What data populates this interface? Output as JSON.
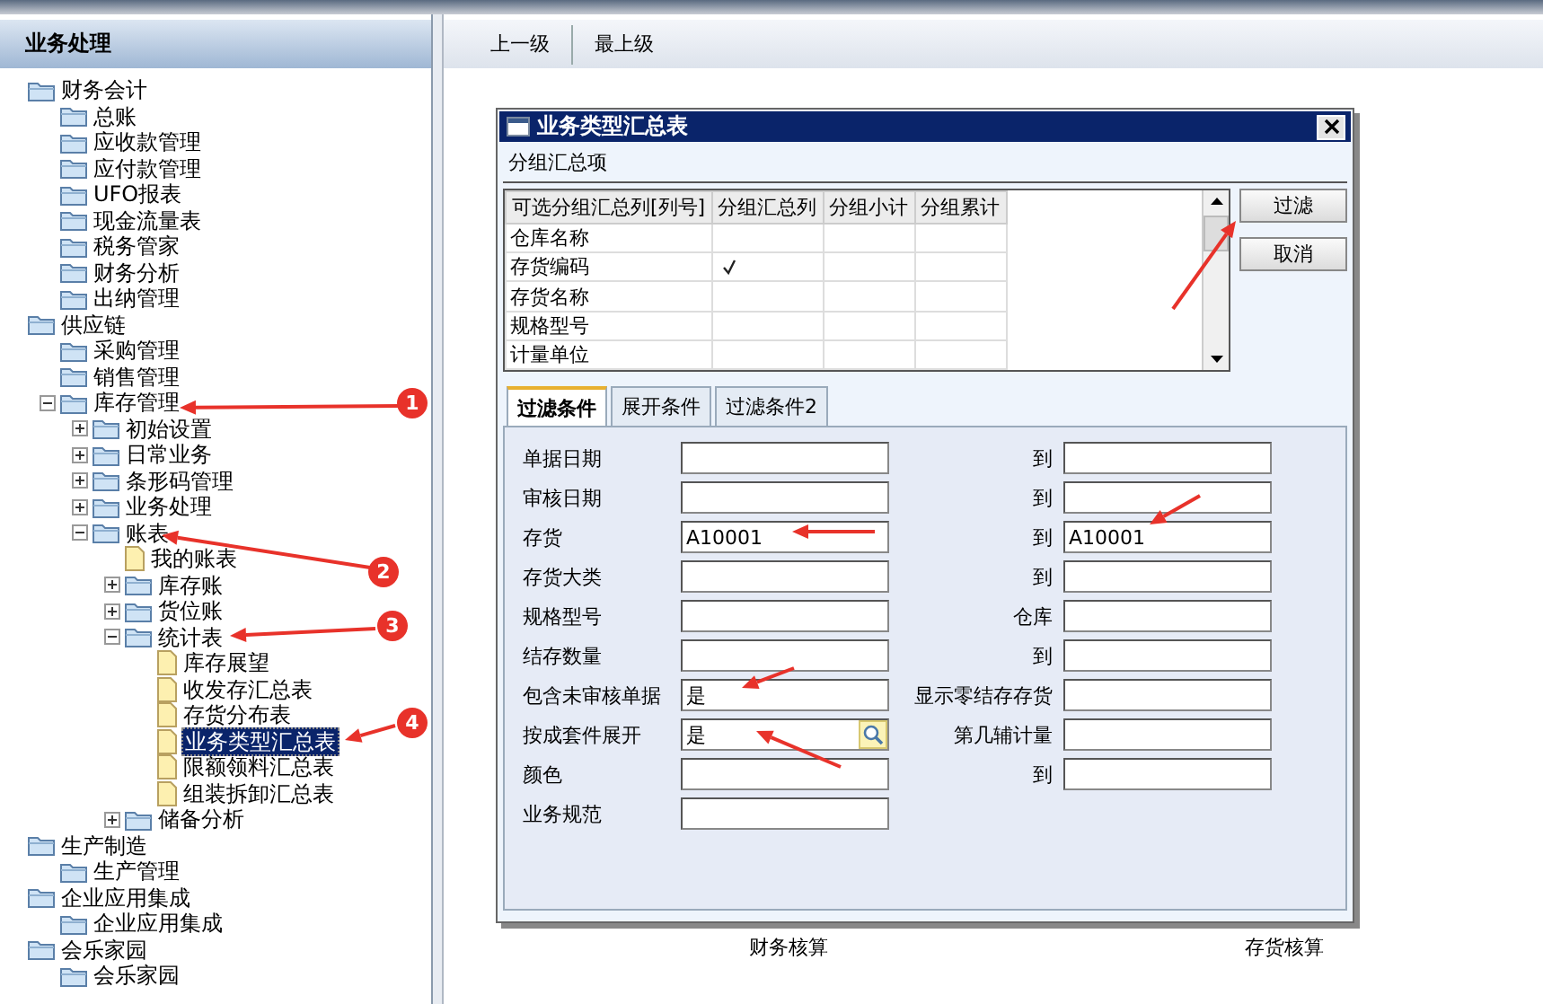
{
  "sidebar": {
    "title": "业务处理",
    "tree": [
      {
        "label": "财务会计",
        "kind": "folder",
        "selected": false,
        "children": [
          {
            "label": "总账",
            "kind": "folder",
            "selected": false
          },
          {
            "label": "应收款管理",
            "kind": "folder",
            "selected": false
          },
          {
            "label": "应付款管理",
            "kind": "folder",
            "selected": false
          },
          {
            "label": "UFO报表",
            "kind": "folder",
            "selected": false
          },
          {
            "label": "现金流量表",
            "kind": "folder",
            "selected": false
          },
          {
            "label": "税务管家",
            "kind": "folder",
            "selected": false
          },
          {
            "label": "财务分析",
            "kind": "folder",
            "selected": false
          },
          {
            "label": "出纳管理",
            "kind": "folder",
            "selected": false
          }
        ]
      },
      {
        "label": "供应链",
        "kind": "folder",
        "selected": false,
        "children": [
          {
            "label": "采购管理",
            "kind": "folder",
            "selected": false
          },
          {
            "label": "销售管理",
            "kind": "folder",
            "selected": false
          },
          {
            "label": "库存管理",
            "kind": "folder",
            "selected": false,
            "expanded": true,
            "children": [
              {
                "label": "初始设置",
                "kind": "folder",
                "selected": false,
                "expanded": false
              },
              {
                "label": "日常业务",
                "kind": "folder",
                "selected": false,
                "expanded": false
              },
              {
                "label": "条形码管理",
                "kind": "folder",
                "selected": false,
                "expanded": false
              },
              {
                "label": "业务处理",
                "kind": "folder",
                "selected": false,
                "expanded": false
              },
              {
                "label": "账表",
                "kind": "folder",
                "selected": false,
                "expanded": true,
                "children": [
                  {
                    "label": "我的账表",
                    "kind": "report",
                    "selected": false
                  },
                  {
                    "label": "库存账",
                    "kind": "folder",
                    "selected": false,
                    "expanded": false
                  },
                  {
                    "label": "货位账",
                    "kind": "folder",
                    "selected": false,
                    "expanded": false
                  },
                  {
                    "label": "统计表",
                    "kind": "folder",
                    "selected": false,
                    "expanded": true,
                    "children": [
                      {
                        "label": "库存展望",
                        "kind": "report",
                        "selected": false
                      },
                      {
                        "label": "收发存汇总表",
                        "kind": "report",
                        "selected": false
                      },
                      {
                        "label": "存货分布表",
                        "kind": "report",
                        "selected": false
                      },
                      {
                        "label": "业务类型汇总表",
                        "kind": "report",
                        "selected": true
                      },
                      {
                        "label": "限额领料汇总表",
                        "kind": "report",
                        "selected": false
                      },
                      {
                        "label": "组装拆卸汇总表",
                        "kind": "report",
                        "selected": false
                      }
                    ]
                  },
                  {
                    "label": "储备分析",
                    "kind": "folder",
                    "selected": false,
                    "expanded": false
                  }
                ]
              }
            ]
          }
        ]
      },
      {
        "label": "生产制造",
        "kind": "folder",
        "selected": false,
        "children": [
          {
            "label": "生产管理",
            "kind": "folder",
            "selected": false
          }
        ]
      },
      {
        "label": "企业应用集成",
        "kind": "folder",
        "selected": false,
        "children": [
          {
            "label": "企业应用集成",
            "kind": "folder",
            "selected": false
          }
        ]
      },
      {
        "label": "会乐家园",
        "kind": "folder",
        "selected": false,
        "children": [
          {
            "label": "会乐家园",
            "kind": "folder",
            "selected": false
          }
        ]
      }
    ]
  },
  "toolbar": [
    "上一级",
    "最上级"
  ],
  "content_labels": [
    "财务核算",
    "存货核算"
  ],
  "dialog": {
    "title": "业务类型汇总表",
    "section": "分组汇总项",
    "grid": {
      "columns": [
        "可选分组汇总列[列号]",
        "分组汇总列",
        "分组小计",
        "分组累计"
      ],
      "rows": [
        {
          "name": "仓库名称",
          "grouped": false
        },
        {
          "name": "存货编码",
          "grouped": true
        },
        {
          "name": "存货名称",
          "grouped": false
        },
        {
          "name": "规格型号",
          "grouped": false
        },
        {
          "name": "计量单位",
          "grouped": false
        }
      ]
    },
    "buttons": [
      "过滤",
      "取消"
    ],
    "tabs": [
      {
        "label": "过滤条件",
        "selected": true
      },
      {
        "label": "展开条件",
        "selected": false
      },
      {
        "label": "过滤条件2",
        "selected": false
      }
    ],
    "fields": [
      {
        "label": "单据日期",
        "right_label": "到"
      },
      {
        "label": "审核日期",
        "right_label": "到"
      },
      {
        "label": "存货",
        "value": "A10001",
        "right_label": "到",
        "right_value": "A10001"
      },
      {
        "label": "存货大类",
        "right_label": "到"
      },
      {
        "label": "规格型号",
        "right_label": "仓库"
      },
      {
        "label": "结存数量",
        "right_label": "到"
      },
      {
        "label": "包含未审核单据",
        "value": "是",
        "right_label": "显示零结存存货"
      },
      {
        "label": "按成套件展开",
        "value": "是",
        "lookup": true,
        "right_label": "第几辅计量"
      },
      {
        "label": "颜色",
        "right_label": "到"
      },
      {
        "label": "业务规范"
      }
    ]
  },
  "annotations": [
    "1",
    "2",
    "3",
    "4"
  ]
}
